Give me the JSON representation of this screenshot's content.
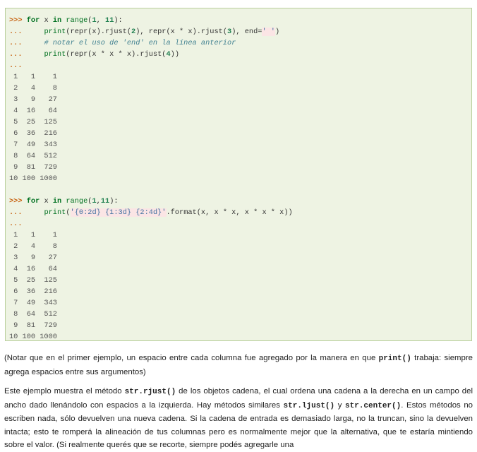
{
  "code": {
    "block1": {
      "l1": {
        "prompt": ">>>",
        "kw_for": "for",
        "mid": " x ",
        "kw_in": "in",
        "sp": " ",
        "fn_range": "range",
        "open": "(",
        "n1": "1",
        "comma": ", ",
        "n2": "11",
        "close": "):"
      },
      "l2": {
        "prompt": "...",
        "indent": "     ",
        "fn_print": "print",
        "a": "(repr(x).rjust(",
        "n2": "2",
        "b": "), repr(x * x).rjust(",
        "n3": "3",
        "c": "), end=",
        "str": "' '",
        "d": ")"
      },
      "l3": {
        "prompt": "...",
        "indent": "     ",
        "comment": "# notar el uso de 'end' en la línea anterior"
      },
      "l4": {
        "prompt": "...",
        "indent": "     ",
        "fn_print": "print",
        "a": "(repr(x * x * x).rjust(",
        "n4": "4",
        "b": "))"
      },
      "l5": {
        "prompt": "..."
      },
      "output": [
        " 1   1    1",
        " 2   4    8",
        " 3   9   27",
        " 4  16   64",
        " 5  25  125",
        " 6  36  216",
        " 7  49  343",
        " 8  64  512",
        " 9  81  729",
        "10 100 1000"
      ]
    },
    "block2": {
      "l1": {
        "prompt": ">>>",
        "kw_for": "for",
        "mid": " x ",
        "kw_in": "in",
        "sp": " ",
        "fn_range": "range",
        "open": "(",
        "n1": "1",
        "comma": ",",
        "n2": "11",
        "close": "):"
      },
      "l2": {
        "prompt": "...",
        "indent": "     ",
        "fn_print": "print",
        "paren": "(",
        "str": "'{0:2d} {1:3d} {2:4d}'",
        "rest": ".format(x, x * x, x * x * x))"
      },
      "l3": {
        "prompt": "..."
      },
      "output": [
        " 1   1    1",
        " 2   4    8",
        " 3   9   27",
        " 4  16   64",
        " 5  25  125",
        " 6  36  216",
        " 7  49  343",
        " 8  64  512",
        " 9  81  729",
        "10 100 1000"
      ]
    }
  },
  "para1": {
    "t1": "(Notar que en el primer ejemplo, un espacio entre cada columna fue agregado por la manera en que ",
    "c1": "print()",
    "t2": " trabaja: siempre agrega espacios entre sus argumentos)"
  },
  "para2": {
    "t1": "Este ejemplo muestra el método ",
    "c1": "str.rjust()",
    "t2": " de los objetos cadena, el cual ordena una cadena a la derecha en un campo del ancho dado llenándolo con espacios a la izquierda. Hay métodos similares ",
    "c2": "str.ljust()",
    "t3": " y ",
    "c3": "str.center()",
    "t4": ". Estos métodos no escriben nada, sólo devuelven una nueva cadena. Si la cadena de entrada es demasiado larga, no la truncan, sino la devuelven intacta; esto te romperá la alineación de tus columnas pero es normalmente mejor que la alternativa, que te estaría mintiendo sobre el valor. (Si realmente querés que se recorte, siempre podés agregarle una"
  }
}
